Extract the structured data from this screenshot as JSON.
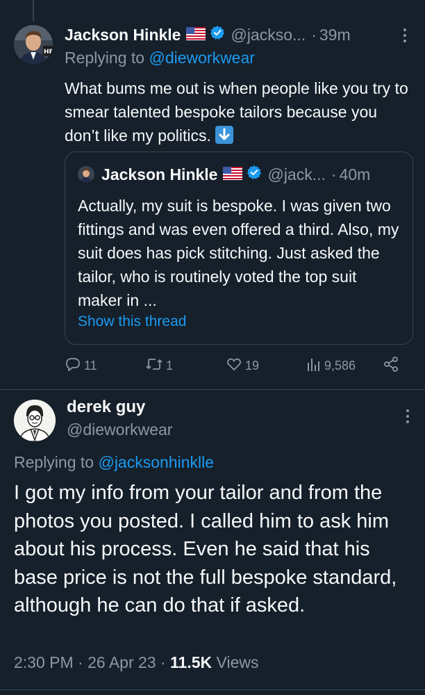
{
  "quoted_parent_tweet": {
    "author": {
      "name": "Jackson Hinkle",
      "flag": "🇺🇸",
      "handle": "@jackso...",
      "avatar_badge": "HB"
    },
    "time": "39m",
    "replying_prefix": "Replying to",
    "replying_handle": "@dieworkwear",
    "text": "What bums me out is when people like you try to smear talented bespoke tailors because you don’t like my politics.",
    "emoji": "down-arrow-emoji",
    "quote": {
      "author": {
        "name": "Jackson Hinkle",
        "handle": "@jack...",
        "time": "40m"
      },
      "text": "Actually, my suit is bespoke. I was given two fittings and was even offered a third. Also, my suit does has pick stitching. Just asked the tailor, who is routinely voted the top suit maker in ...",
      "show_thread": "Show this thread"
    },
    "actions": {
      "replies": "11",
      "retweets": "1",
      "likes": "19",
      "views": "9,586"
    }
  },
  "main_tweet": {
    "author": {
      "name": "derek guy",
      "handle": "@dieworkwear"
    },
    "replying_prefix": "Replying to",
    "replying_handle": "@jacksonhinklle",
    "text": "I got my info from your tailor and from the photos you posted. I called him to ask him about his process. Even he said that his base price is not the full bespoke standard, although he can do that if asked.",
    "meta": {
      "time": "2:30 PM",
      "date": "26 Apr 23",
      "views_count": "11.5K",
      "views_label": "Views"
    }
  },
  "colors": {
    "background": "#15202b",
    "accent": "#1d9bf0",
    "secondary_text": "#8b98a5",
    "border": "#38444d"
  }
}
